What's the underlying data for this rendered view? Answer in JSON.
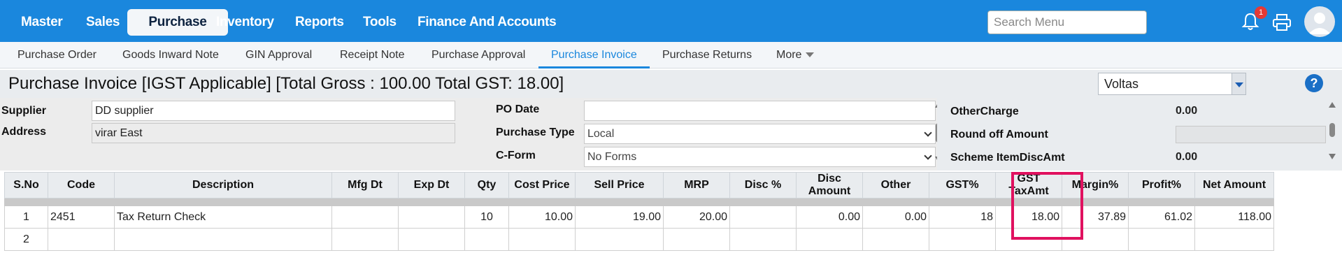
{
  "nav": {
    "items": [
      "Master",
      "Sales",
      "Purchase",
      "Inventory",
      "Reports",
      "Tools",
      "Finance And Accounts"
    ],
    "active": "Purchase",
    "search_placeholder": "Search Menu",
    "notification_count": "1",
    "accent_color": "#1a87dd"
  },
  "subnav": {
    "tabs": [
      "Purchase Order",
      "Goods Inward Note",
      "GIN Approval",
      "Receipt Note",
      "Purchase Approval",
      "Purchase Invoice",
      "Purchase Returns",
      "More"
    ],
    "active": "Purchase Invoice"
  },
  "page": {
    "title": "Purchase Invoice [IGST Applicable] [Total Gross : 100.00 Total GST: 18.00]",
    "company": "Voltas"
  },
  "form": {
    "supplier_label": "Supplier",
    "supplier_value": "DD supplier",
    "address_label": "Address",
    "address_value": "virar East",
    "po_date_label": "PO Date",
    "po_date_value": "",
    "purchase_type_label": "Purchase Type",
    "purchase_type_value": "Local",
    "cform_label": "C-Form",
    "cform_value": "No Forms"
  },
  "charges": {
    "other_charge_label": "OtherCharge",
    "other_charge_value": "0.00",
    "round_off_label": "Round off Amount",
    "round_off_value": "",
    "scheme_label": "Scheme ItemDiscAmt",
    "scheme_value": "0.00"
  },
  "grid": {
    "columns": [
      "S.No",
      "Code",
      "Description",
      "Mfg Dt",
      "Exp Dt",
      "Qty",
      "Cost Price",
      "Sell Price",
      "MRP",
      "Disc %",
      "Disc Amount",
      "Other",
      "GST%",
      "GST TaxAmt",
      "Margin%",
      "Profit%",
      "Net Amount"
    ],
    "rows": [
      {
        "sno": "1",
        "code": "2451",
        "description": "Tax Return Check",
        "mfg": "",
        "exp": "",
        "qty": "10",
        "cost": "10.00",
        "sell": "19.00",
        "mrp": "20.00",
        "disc_pct": "",
        "disc_amt": "0.00",
        "other": "0.00",
        "gst_pct": "18",
        "gst_tax": "18.00",
        "margin": "37.89",
        "profit": "61.02",
        "net": "118.00"
      },
      {
        "sno": "2",
        "code": "",
        "description": "",
        "mfg": "",
        "exp": "",
        "qty": "",
        "cost": "",
        "sell": "",
        "mrp": "",
        "disc_pct": "",
        "disc_amt": "",
        "other": "",
        "gst_pct": "",
        "gst_tax": "",
        "margin": "",
        "profit": "",
        "net": ""
      }
    ],
    "highlight_color": "#e0115f"
  }
}
